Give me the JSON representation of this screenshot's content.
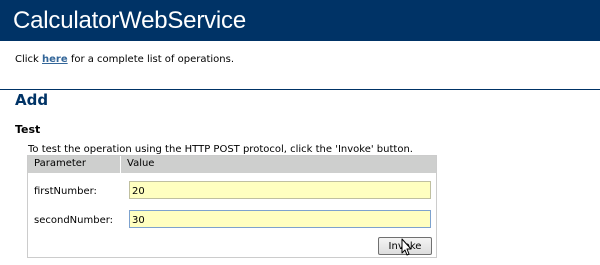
{
  "header": {
    "title": "CalculatorWebService"
  },
  "intro": {
    "prefix": "Click ",
    "link_label": "here",
    "suffix": " for a complete list of operations."
  },
  "operation": {
    "name": "Add",
    "section_title": "Test",
    "instructions": "To test the operation using the HTTP POST protocol, click the 'Invoke' button."
  },
  "form": {
    "columns": [
      "Parameter",
      "Value"
    ],
    "rows": [
      {
        "label": "firstNumber:",
        "value": "20"
      },
      {
        "label": "secondNumber:",
        "value": "30"
      }
    ],
    "invoke_label": "Invoke"
  },
  "colors": {
    "banner": "#003366",
    "link": "#336699",
    "field_bg": "#ffffc0",
    "header_row": "#cecfce"
  },
  "icons": {
    "pointer": "mouse-pointer-icon"
  }
}
